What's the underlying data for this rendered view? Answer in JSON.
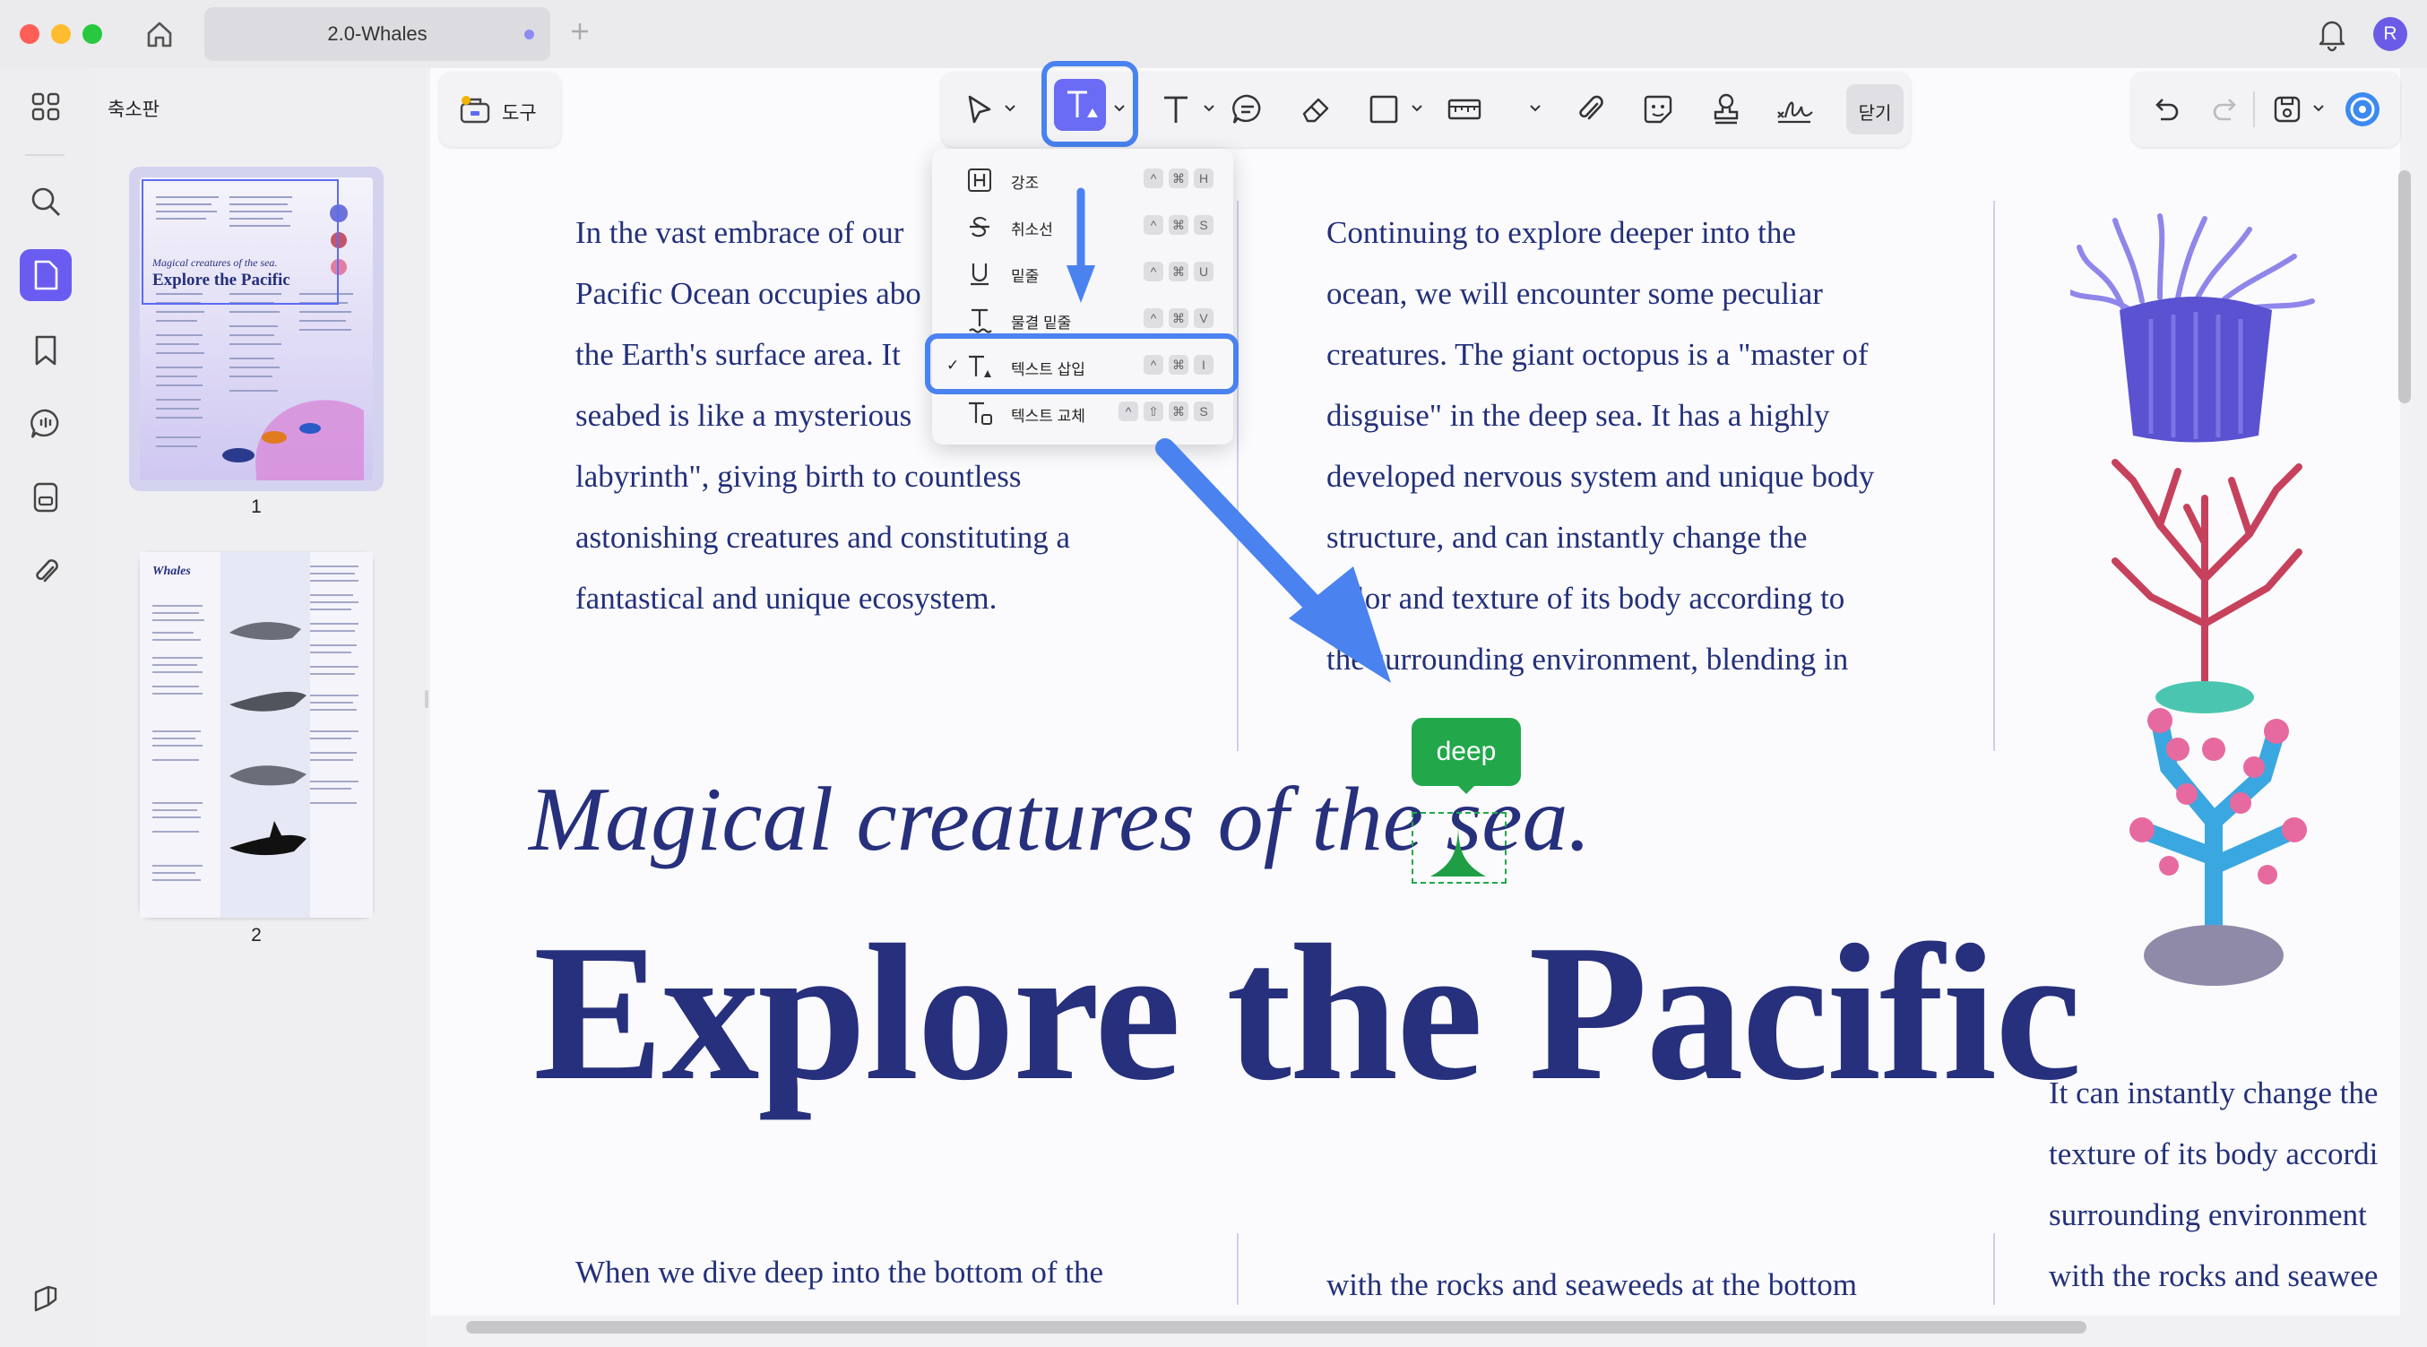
{
  "tab": {
    "title": "2.0-Whales"
  },
  "avatar_letter": "R",
  "sidebar": {
    "title": "축소판",
    "pages": [
      "1",
      "2"
    ],
    "thumb1": {
      "script_title": "Magical creatures of the sea.",
      "title": "Explore the Pacific"
    },
    "thumb2": {
      "title": "Whales"
    }
  },
  "toolbar": {
    "tools_label": "도구",
    "close_label": "닫기"
  },
  "menu": {
    "items": [
      {
        "label": "강조",
        "keys": [
          "^",
          "⌘",
          "H"
        ]
      },
      {
        "label": "취소선",
        "keys": [
          "^",
          "⌘",
          "S"
        ]
      },
      {
        "label": "밑줄",
        "keys": [
          "^",
          "⌘",
          "U"
        ]
      },
      {
        "label": "물결 밑줄",
        "keys": [
          "^",
          "⌘",
          "V"
        ]
      },
      {
        "label": "텍스트 삽입",
        "keys": [
          "^",
          "⌘",
          "I"
        ]
      },
      {
        "label": "텍스트 교체",
        "keys": [
          "^",
          "⇧",
          "⌘",
          "S"
        ]
      }
    ],
    "selected_index": 4
  },
  "document": {
    "col1": [
      "In the vast embrace of our",
      "Pacific Ocean occupies abo",
      "the Earth's surface area. It",
      "seabed is like a mysterious",
      "labyrinth\", giving birth to countless",
      "astonishing creatures and constituting a",
      "fantastical and unique ecosystem."
    ],
    "col2": [
      "Continuing to explore deeper into the",
      "ocean, we will encounter some peculiar",
      "creatures. The giant octopus is a \"master of",
      "disguise\" in the deep sea. It has a highly",
      "developed nervous system and unique body",
      "structure, and can instantly change the",
      "color and texture of its body according to",
      "the surrounding environment, blending in"
    ],
    "headline_script": "Magical creatures of the sea.",
    "headline_main": "Explore the Pacific",
    "right_col": [
      "It can instantly change the",
      "texture of its body accordi",
      "surrounding environment",
      "with the rocks and seawee"
    ],
    "bottom_left": "When we dive deep into the bottom of the",
    "bottom_mid": "with the rocks and seaweeds at the bottom",
    "insert_tooltip": "deep"
  },
  "colors": {
    "accent": "#5b6cf5",
    "text": "#26307c",
    "insert": "#22a84a",
    "arrow": "#4a82f0"
  }
}
